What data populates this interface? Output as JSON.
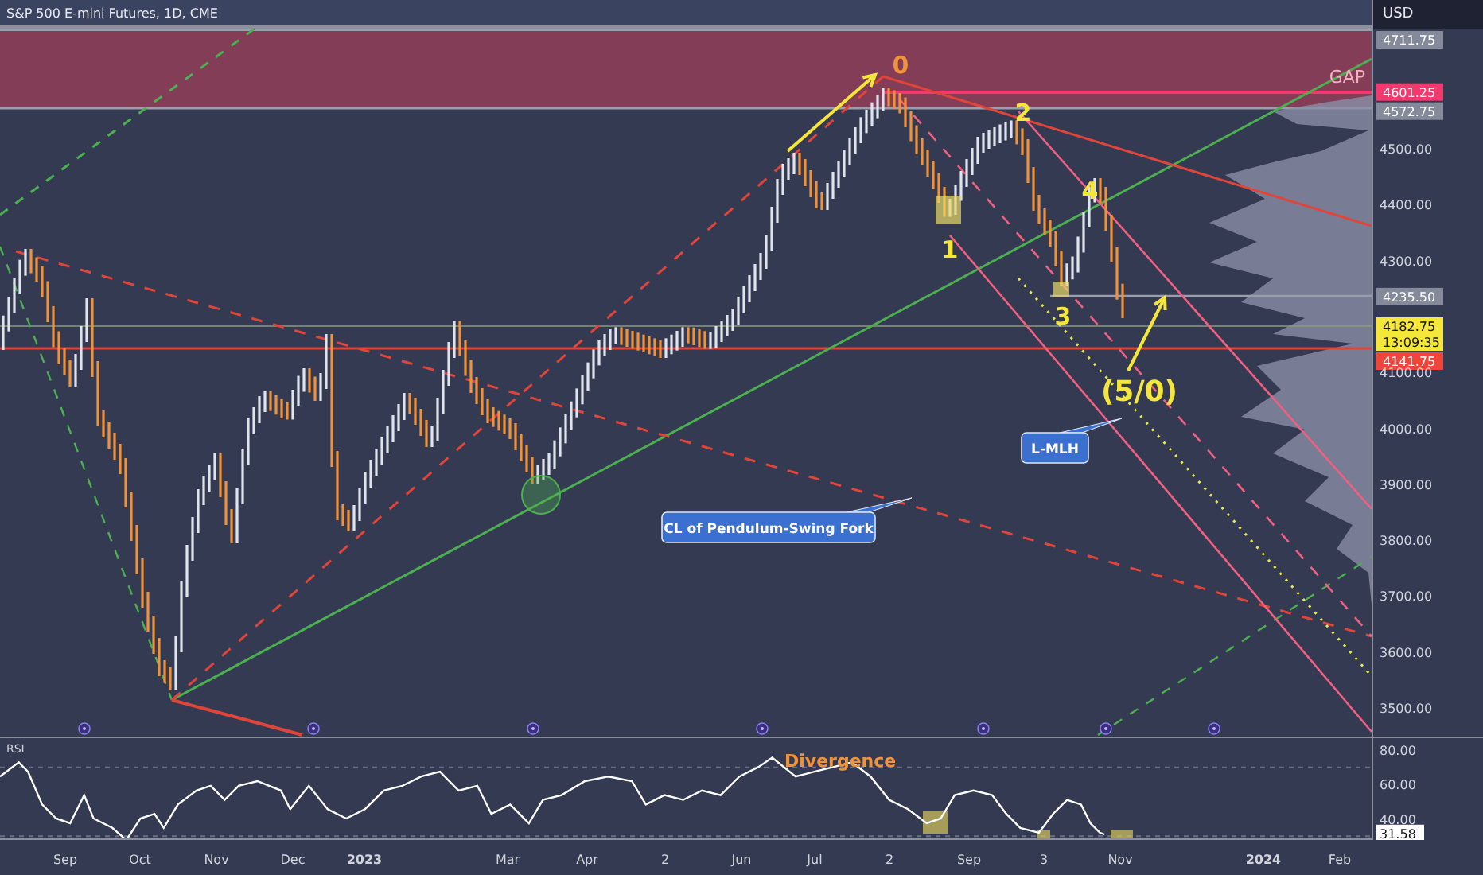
{
  "chart": {
    "title": "S&P 500 E-mini Futures, 1D, CME",
    "currency": "USD",
    "price_axis": [
      {
        "label": "4711.75",
        "kind": "tag",
        "color": "#858a9a"
      },
      {
        "label": "4601.25",
        "kind": "tag",
        "color": "#f23a6e"
      },
      {
        "label": "4572.75",
        "kind": "tag",
        "color": "#858a9a"
      },
      {
        "label": "4500.00",
        "kind": "plain"
      },
      {
        "label": "4400.00",
        "kind": "plain"
      },
      {
        "label": "4300.00",
        "kind": "plain"
      },
      {
        "label": "4235.50",
        "kind": "tag",
        "color": "#858a9a"
      },
      {
        "label": "4182.75",
        "sublabel": "13:09:35",
        "kind": "tag",
        "color": "#f5e63a"
      },
      {
        "label": "4141.75",
        "kind": "tag",
        "color": "#f0453a"
      },
      {
        "label": "4100.00",
        "kind": "plain"
      },
      {
        "label": "4000.00",
        "kind": "plain"
      },
      {
        "label": "3900.00",
        "kind": "plain"
      },
      {
        "label": "3800.00",
        "kind": "plain"
      },
      {
        "label": "3700.00",
        "kind": "plain"
      },
      {
        "label": "3600.00",
        "kind": "plain"
      },
      {
        "label": "3500.00",
        "kind": "plain"
      }
    ],
    "zone_label": "GAP",
    "wave_labels": [
      "0",
      "2",
      "4",
      "1",
      "3",
      "(5/0)"
    ],
    "callouts": [
      "L-MLH",
      "CL of  Pendulum-Swing Fork"
    ]
  },
  "rsi": {
    "title": "RSI",
    "annotation": "Divergence",
    "axis": [
      {
        "label": "80.00",
        "kind": "plain"
      },
      {
        "label": "60.00",
        "kind": "plain"
      },
      {
        "label": "40.00",
        "kind": "plain"
      },
      {
        "label": "31.58",
        "kind": "tag",
        "color": "#ffffff"
      }
    ]
  },
  "time_axis": [
    {
      "label": "Sep",
      "bold": false
    },
    {
      "label": "Oct",
      "bold": false
    },
    {
      "label": "Nov",
      "bold": false
    },
    {
      "label": "Dec",
      "bold": false
    },
    {
      "label": "2023",
      "bold": true
    },
    {
      "label": "Mar",
      "bold": false
    },
    {
      "label": "Apr",
      "bold": false
    },
    {
      "label": "2",
      "bold": false
    },
    {
      "label": "Jun",
      "bold": false
    },
    {
      "label": "Jul",
      "bold": false
    },
    {
      "label": "2",
      "bold": false
    },
    {
      "label": "Sep",
      "bold": false
    },
    {
      "label": "3",
      "bold": false
    },
    {
      "label": "Nov",
      "bold": false
    },
    {
      "label": "2024",
      "bold": true
    },
    {
      "label": "Feb",
      "bold": false
    }
  ]
}
